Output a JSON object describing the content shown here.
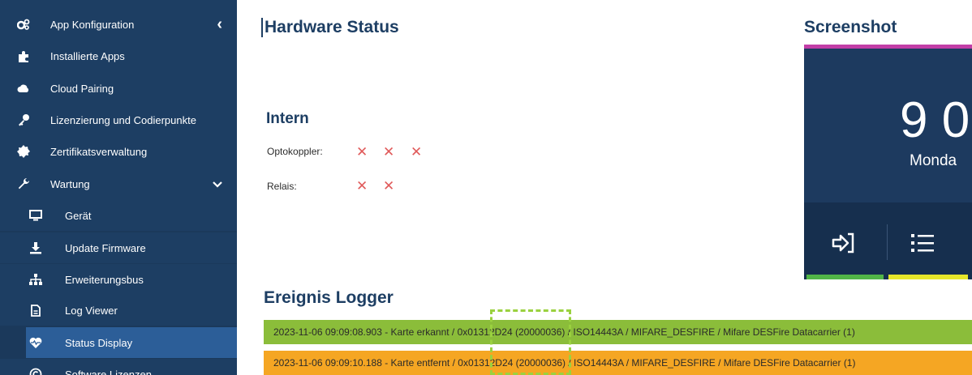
{
  "sidebar": {
    "items": [
      {
        "label": "App Konfiguration",
        "icon": "gears-icon",
        "chevron": "‹"
      },
      {
        "label": "Installierte Apps",
        "icon": "puzzle-icon"
      },
      {
        "label": "Cloud Pairing",
        "icon": "cloud-icon"
      },
      {
        "label": "Lizenzierung und Codierpunkte",
        "icon": "key-icon"
      },
      {
        "label": "Zertifikatsverwaltung",
        "icon": "certificate-icon"
      },
      {
        "label": "Wartung",
        "icon": "wrench-icon",
        "chevron": "⌄"
      }
    ],
    "subitems": [
      {
        "label": "Gerät",
        "icon": "monitor-icon"
      },
      {
        "label": "Update Firmware",
        "icon": "download-icon"
      },
      {
        "label": "Erweiterungsbus",
        "icon": "sitemap-icon"
      },
      {
        "label": "Log Viewer",
        "icon": "file-icon"
      },
      {
        "label": "Status Display",
        "icon": "heartbeat-icon",
        "active": true
      },
      {
        "label": "Software Lizenzen",
        "icon": "copyright-icon"
      }
    ]
  },
  "main": {
    "hardware_title": "Hardware Status",
    "intern_title": "Intern",
    "optokoppler_label": "Optokoppler:",
    "relais_label": "Relais:",
    "optokoppler_marks": [
      "✕",
      "✕",
      "✕"
    ],
    "relais_marks": [
      "✕",
      "✕"
    ],
    "logger_title": "Ereignis Logger",
    "screenshot_title": "Screenshot"
  },
  "screenshot": {
    "clock": "9 0",
    "day": "Monda"
  },
  "log": [
    {
      "text": "2023-11-06 09:09:08.903 - Karte erkannt / 0x01312D24 (20000036) / ISO14443A / MIFARE_DESFIRE / Mifare DESFire Datacarrier (1)",
      "color": "#8bbd3a"
    },
    {
      "text": "2023-11-06 09:09:10.188 - Karte entfernt / 0x01312D24 (20000036) / ISO14443A / MIFARE_DESFIRE / Mifare DESFire Datacarrier (1)",
      "color": "#f5a623"
    }
  ],
  "colors": {
    "sidebar_bg": "#1d3e63",
    "active_item": "#2c5e98",
    "error_mark": "#e05a5a",
    "log_detected": "#8bbd3a",
    "log_removed": "#f5a623"
  }
}
